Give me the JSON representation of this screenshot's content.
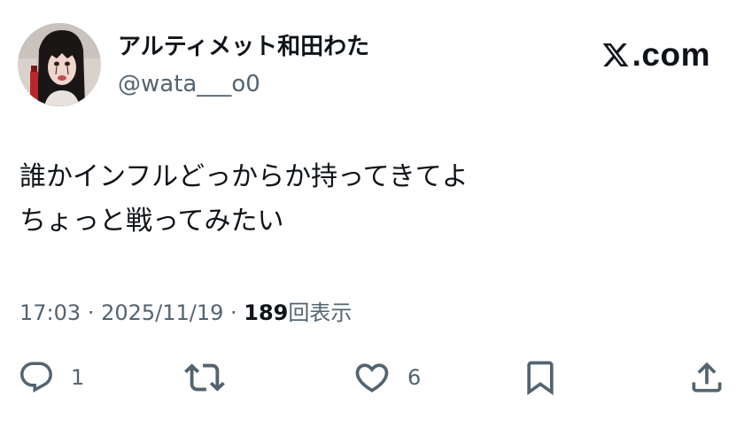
{
  "user": {
    "display_name": "アルティメット和田わた",
    "handle": "@wata___o0"
  },
  "brand": {
    "text": ".com"
  },
  "tweet": {
    "lines": [
      "誰かインフルどっからか持ってきてよ",
      "ちょっと戦ってみたい"
    ]
  },
  "meta": {
    "time": "17:03",
    "separator": " · ",
    "date": "2025/11/19",
    "separator2": " · ",
    "views_count": "189",
    "views_label": "回表示"
  },
  "actions": {
    "reply_icon": "reply-icon",
    "reply_count": "1",
    "retweet_icon": "retweet-icon",
    "like_icon": "heart-icon",
    "like_count": "6",
    "bookmark_icon": "bookmark-icon",
    "share_icon": "share-icon"
  },
  "colors": {
    "text_primary": "#0f1419",
    "text_secondary": "#536471",
    "background": "#ffffff"
  }
}
